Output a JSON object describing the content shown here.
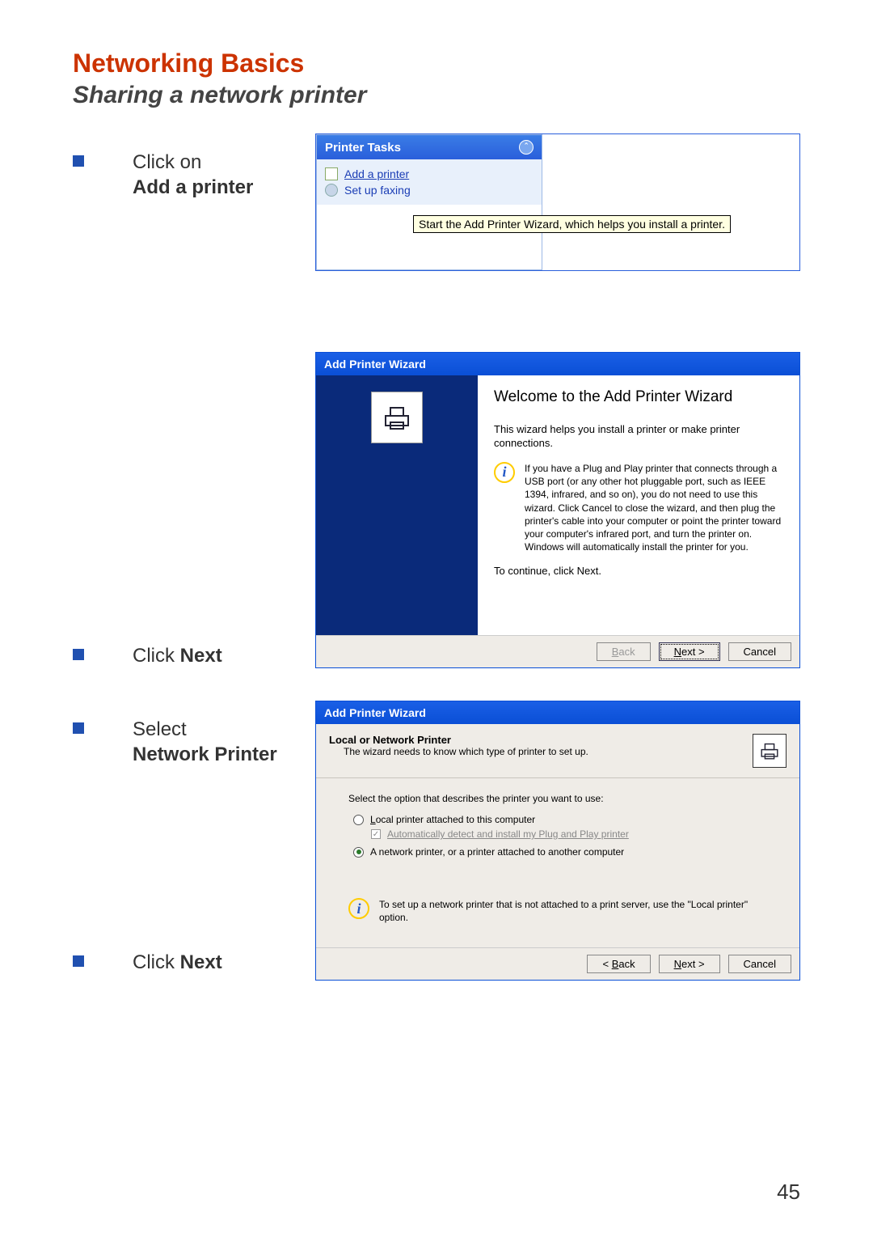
{
  "page": {
    "heading": "Networking Basics",
    "subheading": "Sharing a network printer",
    "page_number": "45"
  },
  "instructions": {
    "step1_a": "Click on",
    "step1_b": "Add a printer",
    "step2_a": "Click ",
    "step2_b": "Next",
    "step3_a": "Select",
    "step3_b": "Network Printer",
    "step4_a": "Click ",
    "step4_b": "Next"
  },
  "printer_tasks": {
    "header": "Printer Tasks",
    "add_printer": "Add a printer",
    "set_up_faxing": "Set up faxing",
    "tooltip": "Start the Add Printer Wizard, which helps you install a printer."
  },
  "wizard1": {
    "title": "Add Printer Wizard",
    "welcome": "Welcome to the Add Printer Wizard",
    "intro": "This wizard helps you install a printer or make printer connections.",
    "info": "If you have a Plug and Play printer that connects through a USB port (or any other hot pluggable port, such as IEEE 1394, infrared, and so on), you do not need to use this wizard. Click Cancel to close the wizard, and then plug the printer's cable into your computer or point the printer toward your computer's infrared port, and turn the printer on. Windows will automatically install the printer for you.",
    "continue": "To continue, click Next.",
    "back": "< Back",
    "next": "Next >",
    "cancel": "Cancel"
  },
  "wizard2": {
    "title": "Add Printer Wizard",
    "header_title": "Local or Network Printer",
    "header_sub": "The wizard needs to know which type of printer to set up.",
    "prompt": "Select the option that describes the printer you want to use:",
    "opt_local": "Local printer attached to this computer",
    "opt_auto": "Automatically detect and install my Plug and Play printer",
    "opt_network": "A network printer, or a printer attached to another computer",
    "info": "To set up a network printer that is not attached to a print server, use the \"Local printer\" option.",
    "back": "< Back",
    "next": "Next >",
    "cancel": "Cancel"
  }
}
